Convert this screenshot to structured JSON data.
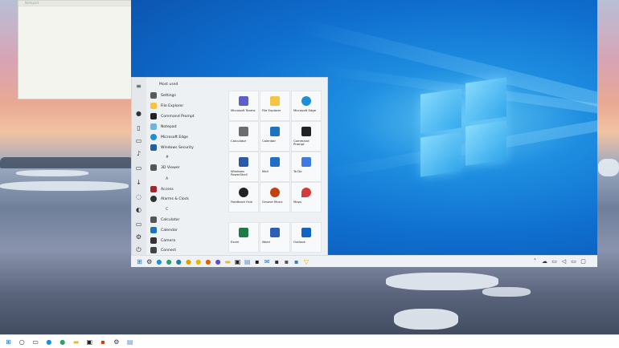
{
  "left_window": {
    "title": "Notepad"
  },
  "start_menu": {
    "header": "Most used",
    "apps": [
      {
        "label": "Settings",
        "icon": "gear-icon",
        "color": "#5a5a5a"
      },
      {
        "label": "File Explorer",
        "icon": "folder-icon",
        "color": "#f4c542"
      },
      {
        "label": "Command Prompt",
        "icon": "terminal-icon",
        "color": "#222222"
      },
      {
        "label": "Notepad",
        "icon": "notepad-icon",
        "color": "#6fb3e0"
      },
      {
        "label": "Microsoft Edge",
        "icon": "edge-icon",
        "color": "#1d8fd8"
      },
      {
        "label": "Windows Security",
        "icon": "shield-icon",
        "color": "#1e5fa8"
      }
    ],
    "section_hash": "#",
    "app_3d": {
      "label": "3D Viewer",
      "icon": "cube-icon",
      "color": "#555555"
    },
    "section_a": "A",
    "apps_a": [
      {
        "label": "Access",
        "icon": "access-icon",
        "color": "#a4262c"
      },
      {
        "label": "Alarms & Clock",
        "icon": "clock-icon",
        "color": "#333333"
      }
    ],
    "section_c": "C",
    "apps_c": [
      {
        "label": "Calculator",
        "icon": "calculator-icon",
        "color": "#555555"
      },
      {
        "label": "Calendar",
        "icon": "calendar-icon",
        "color": "#1e73be"
      },
      {
        "label": "Camera",
        "icon": "camera-icon",
        "color": "#333333"
      },
      {
        "label": "Connect",
        "icon": "connect-icon",
        "color": "#444444"
      }
    ],
    "tiles": [
      {
        "label": "Microsoft Teams",
        "icon": "teams-icon",
        "color": "#5b5fc7"
      },
      {
        "label": "File Explorer",
        "icon": "folder-icon",
        "color": "#f4c542"
      },
      {
        "label": "Microsoft Edge",
        "icon": "edge-icon",
        "color": "#1d8fd8"
      },
      {
        "label": "Calculator",
        "icon": "calculator-icon",
        "color": "#6d6d6d"
      },
      {
        "label": "Calendar",
        "icon": "calendar-icon",
        "color": "#1e73be"
      },
      {
        "label": "Command Prompt",
        "icon": "terminal-icon",
        "color": "#222222"
      },
      {
        "label": "Windows PowerShell",
        "icon": "powershell-icon",
        "color": "#2b5aa8"
      },
      {
        "label": "Mail",
        "icon": "mail-icon",
        "color": "#1f6fc4"
      },
      {
        "label": "To Do",
        "icon": "check-icon",
        "color": "#3d7be0"
      },
      {
        "label": "Feedback Hub",
        "icon": "feedback-icon",
        "color": "#222222"
      },
      {
        "label": "Groove Music",
        "icon": "music-icon",
        "color": "#c2410c"
      },
      {
        "label": "Maps",
        "icon": "map-pin-icon",
        "color": "#d23c3c"
      },
      {
        "label": "Excel",
        "icon": "excel-icon",
        "color": "#1e7a46"
      },
      {
        "label": "Word",
        "icon": "word-icon",
        "color": "#2b5fb3"
      },
      {
        "label": "Outlook",
        "icon": "outlook-icon",
        "color": "#1064c4"
      }
    ]
  },
  "vm_taskbar": {
    "icons": [
      {
        "name": "start-icon",
        "glyph": "⊞",
        "color": "#1e73be"
      },
      {
        "name": "settings-icon",
        "glyph": "⚙",
        "color": "#333333"
      },
      {
        "name": "edge-icon",
        "glyph": "●",
        "color": "#1d8fd8"
      },
      {
        "name": "edge-dev-icon",
        "glyph": "●",
        "color": "#2aa36a"
      },
      {
        "name": "edge-beta-icon",
        "glyph": "●",
        "color": "#1b7fa8"
      },
      {
        "name": "chrome-icon",
        "glyph": "●",
        "color": "#e0a100"
      },
      {
        "name": "canary-icon",
        "glyph": "●",
        "color": "#e6b800"
      },
      {
        "name": "firefox-icon",
        "glyph": "●",
        "color": "#e66000"
      },
      {
        "name": "firefox-nightly-icon",
        "glyph": "●",
        "color": "#5a4fd0"
      },
      {
        "name": "explorer-icon",
        "glyph": "▬",
        "color": "#e8b93a"
      },
      {
        "name": "store-icon",
        "glyph": "▣",
        "color": "#222222"
      },
      {
        "name": "notepad-icon",
        "glyph": "▤",
        "color": "#5b8fc4"
      },
      {
        "name": "terminal-icon",
        "glyph": "▪",
        "color": "#222222"
      },
      {
        "name": "mail-icon",
        "glyph": "✉",
        "color": "#1f6fc4"
      },
      {
        "name": "media-icon",
        "glyph": "▪",
        "color": "#333333"
      },
      {
        "name": "app-icon",
        "glyph": "▪",
        "color": "#555555"
      },
      {
        "name": "photos-icon",
        "glyph": "▪",
        "color": "#3a7dc0"
      },
      {
        "name": "vs-icon",
        "glyph": "▽",
        "color": "#e6a700"
      }
    ],
    "tray": [
      {
        "name": "chevron-up-icon",
        "glyph": "˄"
      },
      {
        "name": "onedrive-icon",
        "glyph": "☁"
      },
      {
        "name": "network-icon",
        "glyph": "▭"
      },
      {
        "name": "volume-icon",
        "glyph": "◁"
      },
      {
        "name": "battery-icon",
        "glyph": "▭"
      },
      {
        "name": "notification-icon",
        "glyph": "▢"
      }
    ]
  },
  "host_taskbar": {
    "icons": [
      {
        "name": "start-icon",
        "glyph": "⊞",
        "color": "#1e73be"
      },
      {
        "name": "search-icon",
        "glyph": "○",
        "color": "#333333"
      },
      {
        "name": "task-view-icon",
        "glyph": "▭",
        "color": "#333333"
      },
      {
        "name": "edge-icon",
        "glyph": "●",
        "color": "#1d8fd8"
      },
      {
        "name": "edge-dev-icon",
        "glyph": "●",
        "color": "#2aa36a"
      },
      {
        "name": "explorer-icon",
        "glyph": "▬",
        "color": "#e8b93a"
      },
      {
        "name": "store-icon",
        "glyph": "▣",
        "color": "#222222"
      },
      {
        "name": "office-icon",
        "glyph": "▪",
        "color": "#d83b01"
      },
      {
        "name": "settings-icon",
        "glyph": "⚙",
        "color": "#333333"
      },
      {
        "name": "notepad-icon",
        "glyph": "▤",
        "color": "#5b8fc4"
      }
    ]
  }
}
